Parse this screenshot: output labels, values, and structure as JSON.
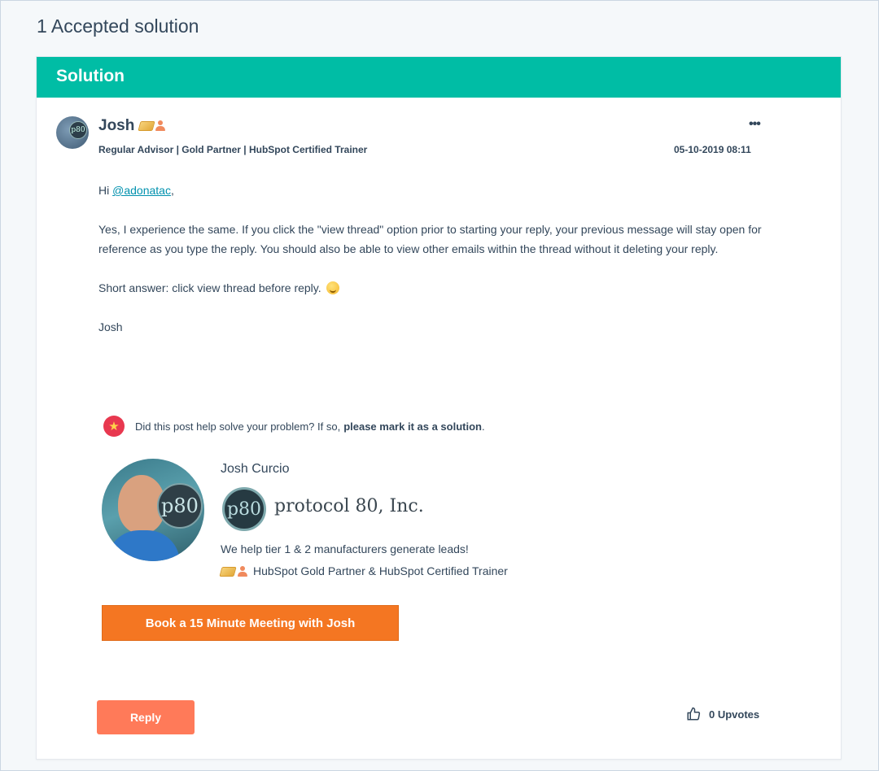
{
  "page": {
    "accepted_heading": "1 Accepted solution"
  },
  "solution_card": {
    "header_title": "Solution",
    "header_color": "#00bda5",
    "author": {
      "name": "Josh",
      "role": "Regular Advisor | Gold Partner | HubSpot Certified Trainer",
      "avatar_logo_text": "p80"
    },
    "post_date": "05-10-2019 08:11",
    "more_menu": "•••",
    "body": {
      "greeting_prefix": "Hi ",
      "mention": "@adonatac",
      "greeting_suffix": ",",
      "paragraph": "Yes, I experience the same. If you click the \"view thread\" option prior to starting your reply, your previous message will stay open for reference as you type the reply. You should also be able to view other emails within the thread without it deleting your reply.",
      "short_answer": "Short answer: click view thread before reply.",
      "signoff": "Josh"
    },
    "help_prompt": {
      "text": "Did this post help solve your problem? If so,",
      "strong": "please mark it as a solution",
      "end": "."
    },
    "signature": {
      "photo_logo_text": "p80",
      "name": "Josh Curcio",
      "company_logo_text": "p80",
      "company_name": "protocol 80, Inc.",
      "tagline": "We help tier 1 & 2 manufacturers generate leads!",
      "partner_text": "HubSpot Gold Partner & HubSpot Certified Trainer"
    },
    "book_button_label": "Book a 15 Minute Meeting with Josh",
    "book_button_color": "#f47622",
    "reply_label": "Reply",
    "reply_color": "#ff7a59",
    "upvotes_label": "0 Upvotes"
  }
}
